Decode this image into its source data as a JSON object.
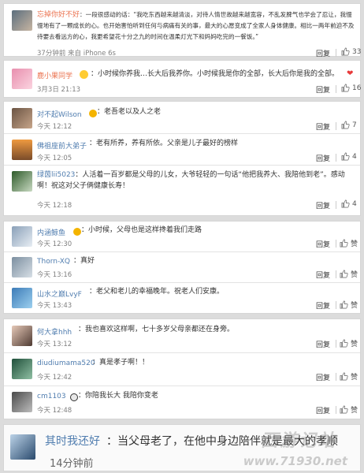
{
  "comments": [
    {
      "name": "忘掉你好不好",
      "text": "：一段很感动的话：“我吃东西越来越清淡，对待人情世故越来越宽容，不乱发脾气也学会了忍让，我慢慢地有了一颗成长的心。也开始害怕听到任何与病痛有关的事，最大的心愿变成了全家人身体健康。相比一两年前迫不及待要去看远方的心，我更希望花十分之九的时间在温柔灯光下和妈妈吃完的一餐饭。”",
      "time": "37分钟前 来自 iPhone 6s",
      "reply": "回复",
      "likes": "33"
    },
    {
      "name": "鹿小果同学",
      "text": "：小时候你养我…长大后我养你。小时候我是你的全部，长大后你是我的全部。",
      "time": "3月3日 21:13",
      "reply": "回复",
      "likes": "16"
    }
  ],
  "replies": [
    {
      "name": "对不起Wilson",
      "text": "：老吾老以及人之老",
      "time": "今天 12:12",
      "reply": "回复",
      "likes": "7"
    },
    {
      "name": "佛祖座前大弟子",
      "text": "：老有所养，养有所依。父亲是儿子最好的榜样",
      "time": "今天 12:05",
      "reply": "回复",
      "likes": "4"
    },
    {
      "name": "绿茵lii5023",
      "text": "：人活着一百岁都是父母的儿女，大爷轻轻的一句话“他把我养大、我陪他到老”。感动啊！祝这对父子俩健康长寿！",
      "time": "今天 12:18",
      "reply": "回复",
      "likes": "4"
    },
    {
      "name": "内涵鲸鱼",
      "text": "：小时候，父母也是这样搀着我们走路",
      "time": "今天 12:30",
      "reply": "回复",
      "likes": "赞"
    },
    {
      "name": "Thorn-XQ",
      "text": "：真好",
      "time": "今天 13:16",
      "reply": "回复",
      "likes": "赞"
    },
    {
      "name": "山水之巅LvyF",
      "text": "：老父和老儿的幸福晚年。祝老人们安康。",
      "time": "今天 13:43",
      "reply": "回复",
      "likes": "赞"
    },
    {
      "name": "何大拿hhh",
      "text": "：我也喜欢这样啊，七十多岁父母亲都还在身旁。",
      "time": "今天 13:12",
      "reply": "回复",
      "likes": "赞"
    },
    {
      "name": "diudiumama520",
      "text": "：真是孝子啊！！",
      "time": "今天 12:42",
      "reply": "回复",
      "likes": "赞"
    },
    {
      "name": "cm1103",
      "text": "：你陪我长大 我陪你变老",
      "time": "今天 12:48",
      "reply": "回复",
      "likes": "赞"
    }
  ],
  "last": {
    "name": "其时我还好",
    "text": "：当父母老了，在他中身边陪伴就是最大的孝顺",
    "time": "14分钟前"
  },
  "watermark": "西游记站",
  "watermark_url": "www.71930.net"
}
